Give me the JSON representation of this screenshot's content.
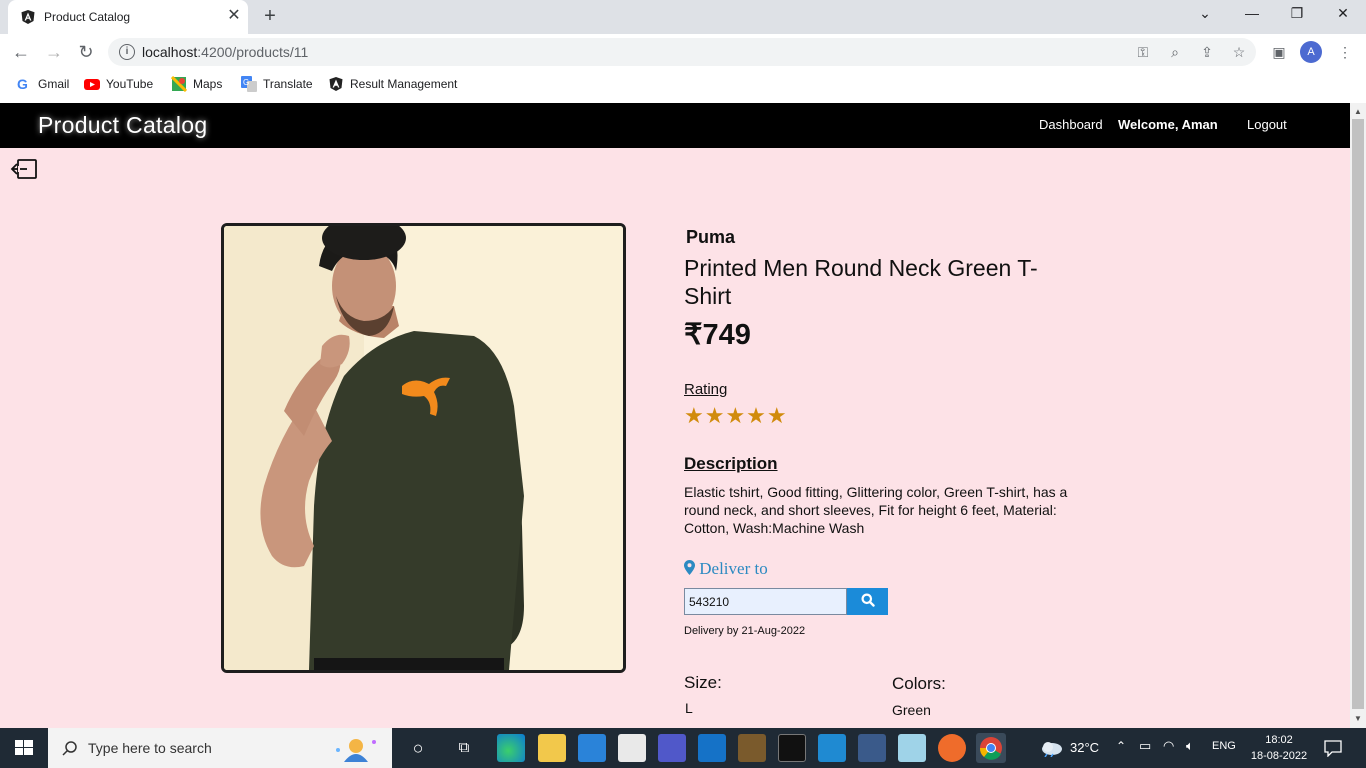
{
  "browser": {
    "tab_title": "Product Catalog",
    "url_host": "localhost",
    "url_rest": ":4200/products/11",
    "avatar_letter": "A",
    "bookmarks": [
      "Gmail",
      "YouTube",
      "Maps",
      "Translate",
      "Result Management"
    ]
  },
  "navbar": {
    "brand": "Product Catalog",
    "dashboard": "Dashboard",
    "welcome": "Welcome, Aman",
    "logout": "Logout"
  },
  "product": {
    "brand": "Puma",
    "title": "Printed Men Round Neck Green T-Shirt",
    "price": "₹749",
    "rating_label": "Rating",
    "rating_value": 5,
    "rating_max": 5,
    "stars": "★★★★★",
    "description_label": "Description",
    "description": "Elastic tshirt, Good fitting, Glittering color, Green T-shirt, has a round neck, and short sleeves, Fit for height 6 feet, Material: Cotton, Wash:Machine Wash",
    "deliver_label": "Deliver to",
    "pincode": "543210",
    "delivery_date": "Delivery by 21-Aug-2022",
    "size_label": "Size:",
    "size_value": "L",
    "colors_label": "Colors:",
    "colors_value": "Green"
  },
  "taskbar": {
    "search_placeholder": "Type here to search",
    "temperature": "32°C",
    "language": "ENG",
    "time": "18:02",
    "date": "18-08-2022"
  },
  "colors": {
    "page_bg": "#fde2e7",
    "navbar_bg": "#000000",
    "star": "#d18b0c",
    "deliver_link": "#2c8ac2",
    "search_button": "#1b8bd9"
  }
}
